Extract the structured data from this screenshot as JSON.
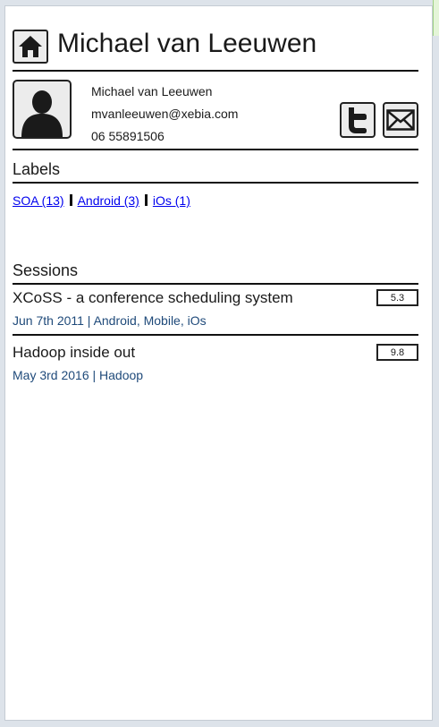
{
  "header": {
    "title": "Michael van Leeuwen",
    "home_icon": "home-icon"
  },
  "profile": {
    "name": "Michael van Leeuwen",
    "email": "mvanleeuwen@xebia.com",
    "phone": "06 55891506",
    "avatar_icon": "user-silhouette-icon",
    "social": [
      {
        "icon": "twitter-icon"
      },
      {
        "icon": "mail-icon"
      }
    ]
  },
  "labels": {
    "heading": "Labels",
    "items": [
      {
        "text": "SOA (13)"
      },
      {
        "text": "Android (3)"
      },
      {
        "text": "iOs (1)"
      }
    ]
  },
  "sessions": {
    "heading": "Sessions",
    "items": [
      {
        "title": "XCoSS - a conference scheduling system",
        "meta": "Jun 7th 2011 | Android, Mobile, iOs",
        "score": "5.3"
      },
      {
        "title": "Hadoop inside out",
        "meta": "May 3rd 2016 | Hadoop",
        "score": "9.8"
      }
    ]
  },
  "colors": {
    "link": "#0000ee",
    "meta_text": "#1f4a7a",
    "button_bg": "#ececec"
  }
}
